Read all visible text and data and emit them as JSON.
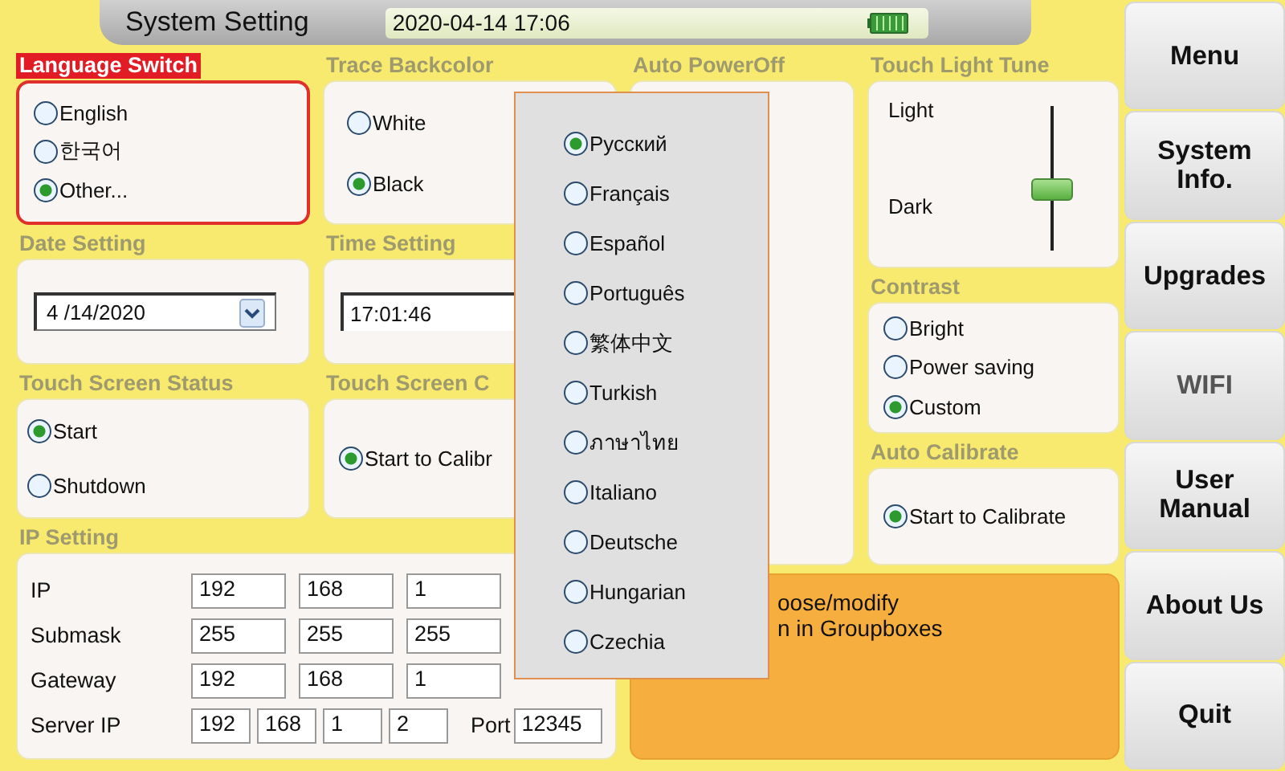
{
  "header": {
    "title": "System Setting",
    "datetime": "2020-04-14 17:06"
  },
  "language_switch": {
    "title": "Language Switch",
    "options": [
      {
        "label": "English",
        "selected": false
      },
      {
        "label": "한국어",
        "selected": false
      },
      {
        "label": "Other...",
        "selected": true
      }
    ]
  },
  "trace_backcolor": {
    "title": "Trace Backcolor",
    "options": [
      {
        "label": "White",
        "selected": false
      },
      {
        "label": "Black",
        "selected": true
      }
    ]
  },
  "auto_poweroff": {
    "title": "Auto PowerOff"
  },
  "touch_light_tune": {
    "title": "Touch Light Tune",
    "top_label": "Light",
    "bottom_label": "Dark",
    "level": 0.42
  },
  "date_setting": {
    "title": "Date Setting",
    "value": "4 /14/2020"
  },
  "time_setting": {
    "title": "Time Setting",
    "value": "17:01:46"
  },
  "contrast": {
    "title": "Contrast",
    "options": [
      {
        "label": "Bright",
        "selected": false
      },
      {
        "label": "Power saving",
        "selected": false
      },
      {
        "label": "Custom",
        "selected": true
      }
    ]
  },
  "touch_screen_status": {
    "title": "Touch Screen Status",
    "options": [
      {
        "label": "Start",
        "selected": true
      },
      {
        "label": "Shutdown",
        "selected": false
      }
    ]
  },
  "touch_screen_calibrate": {
    "title": "Touch Screen C",
    "options": [
      {
        "label": "Start to Calibr",
        "selected": true
      }
    ]
  },
  "auto_calibrate": {
    "title": "Auto Calibrate",
    "options": [
      {
        "label": "Start to Calibrate",
        "selected": true
      }
    ]
  },
  "ip_setting": {
    "title": "IP Setting",
    "rows": [
      {
        "label": "IP",
        "fields": [
          "192",
          "168",
          "1"
        ]
      },
      {
        "label": "Submask",
        "fields": [
          "255",
          "255",
          "255"
        ]
      },
      {
        "label": "Gateway",
        "fields": [
          "192",
          "168",
          "1"
        ]
      }
    ],
    "server": {
      "label": "Server IP",
      "fields": [
        "192",
        "168",
        "1",
        "2"
      ],
      "port_label": "Port",
      "port": "12345"
    }
  },
  "notice": {
    "lines": [
      "oose/modify",
      "n in Groupboxes"
    ]
  },
  "language_menu": [
    {
      "label": "Русский",
      "selected": true
    },
    {
      "label": "Français",
      "selected": false
    },
    {
      "label": "Español",
      "selected": false
    },
    {
      "label": "Português",
      "selected": false
    },
    {
      "label": "繁体中文",
      "selected": false
    },
    {
      "label": "Turkish",
      "selected": false
    },
    {
      "label": "ภาษาไทย",
      "selected": false
    },
    {
      "label": "Italiano",
      "selected": false
    },
    {
      "label": "Deutsche",
      "selected": false
    },
    {
      "label": "Hungarian",
      "selected": false
    },
    {
      "label": "Czechia",
      "selected": false
    }
  ],
  "sidebar": [
    {
      "label": "Menu",
      "disabled": false
    },
    {
      "label": "System\nInfo.",
      "disabled": false
    },
    {
      "label": "Upgrades",
      "disabled": false
    },
    {
      "label": "WIFI",
      "disabled": true
    },
    {
      "label": "User\nManual",
      "disabled": false
    },
    {
      "label": "About Us",
      "disabled": false
    },
    {
      "label": "Quit",
      "disabled": false
    }
  ]
}
